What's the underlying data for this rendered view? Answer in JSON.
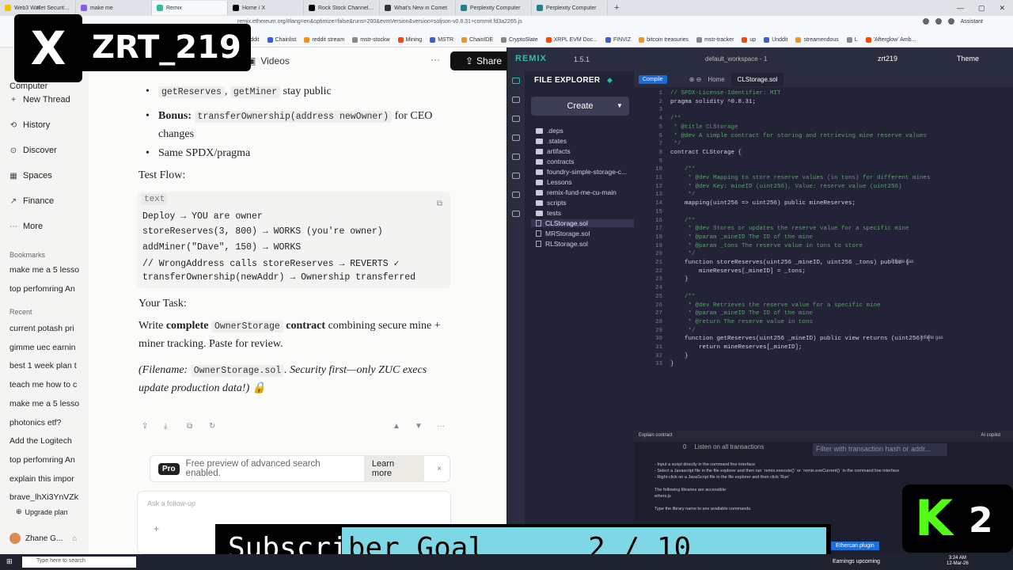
{
  "browser": {
    "tabs": [
      {
        "label": "Web3 Wallet Security Bas",
        "color": "#f2c200",
        "active": false
      },
      {
        "label": "make me",
        "color": "#8a5cf6",
        "active": false
      },
      {
        "label": "Remix",
        "color": "#2fbfa0",
        "active": true
      },
      {
        "label": "Home / X",
        "color": "#000000",
        "active": false
      },
      {
        "label": "Rock Stock Channel (RS",
        "color": "#000000",
        "active": false
      },
      {
        "label": "What's New in Comet",
        "color": "#333333",
        "active": false
      },
      {
        "label": "Perplexity Computer",
        "color": "#20808d",
        "active": false
      },
      {
        "label": "Perplexity Computer",
        "color": "#20808d",
        "active": false
      }
    ],
    "newtab": "+",
    "url": "remix.ethereum.org/#lang=en&optimize=false&runs=200&evmVersion&version=soljson-v0.8.31+commit.fd3a2265.js",
    "assistant": "Assistant",
    "bookmarks": [
      "reddit",
      "Chainlist",
      "reddit stream",
      "mstr-stockw",
      "Mining",
      "MSTR",
      "ChainIDE",
      "CryptoSlate",
      "XRPL EVM Doc...",
      "FINVIZ",
      "bitcoin treasuries",
      "mstr-tracker",
      "up",
      "Unddit",
      "streamendous",
      "L",
      "'Afterglow' Amb..."
    ]
  },
  "overlay": {
    "x_handle": "ZRT_219",
    "x_logo": "X",
    "subscriber_goal": "Subscriber Goal",
    "subscriber_count": "2 / 10",
    "subscriber_progress": 0.2,
    "kick_logo": "K",
    "kick_number": "2"
  },
  "sidebar": {
    "computer": "Computer",
    "new_thread": "New Thread",
    "nav": [
      {
        "label": "History",
        "icon": "history-icon"
      },
      {
        "label": "Discover",
        "icon": "discover-icon"
      },
      {
        "label": "Spaces",
        "icon": "spaces-icon"
      },
      {
        "label": "Finance",
        "icon": "finance-icon"
      },
      {
        "label": "More",
        "icon": "more-icon"
      }
    ],
    "bookmarks_header": "Bookmarks",
    "bookmarks": [
      "make me a 5 lesso",
      "top perfomring An"
    ],
    "recent_header": "Recent",
    "recent": [
      "current potash pri",
      "gimme uec earnin",
      "best 1 week plan t",
      "teach me how to c",
      "make me a 5 lesso",
      "photonics etf?",
      "Add the Logitech",
      "top perfomring An",
      "explain this impor",
      "brave_lhXi3YnVZk"
    ],
    "upgrade": "Upgrade plan",
    "user": "Zhane G..."
  },
  "chat": {
    "videos_tab": "Videos",
    "share": "Share",
    "bullets": [
      {
        "code1": "getReserves",
        "sep": ", ",
        "code2": "getMiner",
        "rest": " stay public"
      },
      {
        "bold": "Bonus:",
        "code1": "transferOwnership(address newOwner)",
        "rest": " for CEO changes"
      },
      {
        "rest": "Same SPDX/pragma"
      }
    ],
    "test_flow": "Test Flow:",
    "code_lang": "text",
    "code_lines": [
      "Deploy → YOU are owner",
      "storeReserves(3, 800) → WORKS (you're owner)",
      "addMiner(\"Dave\", 150) → WORKS",
      "// WrongAddress calls storeReserves → REVERTS ✓",
      "transferOwnership(newAddr) → Ownership transferred"
    ],
    "your_task": "Your Task:",
    "task_pre": "Write ",
    "task_bold1": "complete",
    "task_code": "OwnerStorage",
    "task_bold2": "contract",
    "task_post": " combining secure mine + miner tracking. Paste for review.",
    "filename_pre": "(Filename: ",
    "filename_code": "OwnerStorage.sol",
    "filename_post": ". Security first—only ZUC execs update production data!) 🔒",
    "pro_badge": "Pro",
    "pro_text": "Free preview of advanced search enabled.",
    "learn_more": "Learn more",
    "ask_placeholder": "Ask a follow-up"
  },
  "remix": {
    "logo": "REMIX",
    "version": "1.5.1",
    "workspace": "default_workspace - 1",
    "user": "zrt219",
    "theme": "Theme",
    "file_explorer": "FILE EXPLORER",
    "create": "Create",
    "files": [
      {
        "name": ".deps",
        "type": "folder"
      },
      {
        "name": ".states",
        "type": "folder"
      },
      {
        "name": "artifacts",
        "type": "folder"
      },
      {
        "name": "contracts",
        "type": "folder"
      },
      {
        "name": "foundry-simple-storage-c...",
        "type": "folder"
      },
      {
        "name": "Lessons",
        "type": "folder"
      },
      {
        "name": "remix-fund-me-cu-main",
        "type": "folder"
      },
      {
        "name": "scripts",
        "type": "folder"
      },
      {
        "name": "tests",
        "type": "folder"
      },
      {
        "name": "CLStorage.sol",
        "type": "file",
        "selected": true
      },
      {
        "name": "MRStorage.sol",
        "type": "file"
      },
      {
        "name": "RLStorage.sol",
        "type": "file"
      }
    ],
    "compile": "Compile",
    "home_tab": "Home",
    "file_tab": "CLStorage.sol",
    "code": [
      "// SPDX-License-Identifier: MIT",
      "pragma solidity ^0.8.31;",
      "",
      "/**",
      " * @title CLStorage",
      " * @dev A simple contract for storing and retrieving mine reserve values",
      " */",
      "contract CLStorage {",
      "",
      "    /**",
      "     * @dev Mapping to store reserve values (in tons) for different mines",
      "     * @dev Key: mineID (uint256), Value: reserve value (uint256)",
      "     */",
      "    mapping(uint256 => uint256) public mineReserves;",
      "",
      "    /**",
      "     * @dev Stores or updates the reserve value for a specific mine",
      "     * @param _mineID The ID of the mine",
      "     * @param _tons The reserve value in tons to store",
      "     */",
      "    function storeReserves(uint256 _mineID, uint256 _tons) public {",
      "        mineReserves[_mineID] = _tons;",
      "    }",
      "",
      "    /**",
      "     * @dev Retrieves the reserve value for a specific mine",
      "     * @param _mineID The ID of the mine",
      "     * @return The reserve value in tons",
      "     */",
      "    function getReserves(uint256 _mineID) public view returns (uint256) {",
      "        return mineReserves[_mineID];",
      "    }",
      "}"
    ],
    "infinite_gas": "infinite gas",
    "explain": "Explain contract",
    "ai_copilot": "AI copilot",
    "listen": "Listen on all transactions",
    "filter_placeholder": "Filter with transaction hash or addr...",
    "term_count": "0",
    "terminal_lines": [
      "- Input a script directly in the command line interface",
      "- Select a Javascript file in the file explorer and then run `remix.execute()` or `remix.exeCurrent()` in the command line interface",
      "- Right-click on a JavaScript file in the file explorer and then click 'Run'",
      "",
      "The following libraries are accessible:",
      "ethers.js",
      "",
      "Type the library name to see available commands."
    ],
    "plugin": "Ethercan plugin"
  },
  "taskbar": {
    "search": "Type here to search",
    "earnings": "Earnings upcoming",
    "time": "3:24 AM",
    "date": "12-Mar-26"
  }
}
